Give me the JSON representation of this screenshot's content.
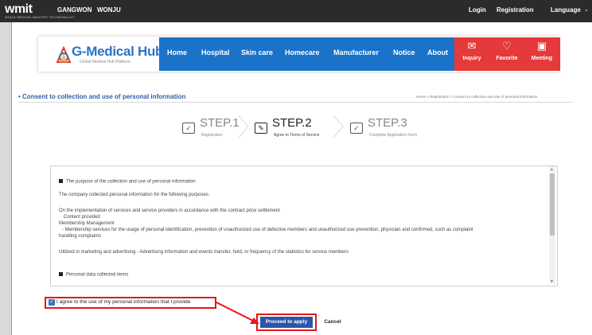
{
  "topbar": {
    "logo": "wmit",
    "logo_sub": "WONJU MEDICAL INDUSTRY TECHNOVALLEY",
    "region_1": "GANGWON",
    "region_2": "WONJU",
    "login": "Login",
    "registration": "Registration",
    "language": "Language"
  },
  "brand": {
    "title": "G-Medical Hub",
    "subtitle": "Global Medical Hub Platform"
  },
  "nav": {
    "items": [
      "Home",
      "Hospital",
      "Skin care",
      "Homecare",
      "Manufacturer",
      "Notice",
      "About"
    ],
    "actions": [
      {
        "label": "Inquiry",
        "icon": "envelope-icon"
      },
      {
        "label": "Favorite",
        "icon": "heart-icon"
      },
      {
        "label": "Meeting",
        "icon": "calendar-icon"
      }
    ],
    "blue": "#1a72c9",
    "red": "#e5393a"
  },
  "page": {
    "title": "Consent to collection and use of personal information",
    "breadcrumb": "Home > Registration > Consent to collection and use of personal information"
  },
  "steps": [
    {
      "name": "STEP.1",
      "sub": "Registration",
      "active": false
    },
    {
      "name": "STEP.2",
      "sub": "Agree to Terms of Service",
      "active": true
    },
    {
      "name": "STEP.3",
      "sub": "Complete Application Form",
      "active": false
    }
  ],
  "terms": {
    "heading": "The purpose of the collection and use of personal information",
    "p1": "The company collected personal information for the following purposes.",
    "p2": "On the implementation of services and service providers in accordance with the contract price settlement",
    "p3": "Content provided",
    "p4": "Membership Management",
    "p5": "- Membership services for the usage of personal identification, prevention of unauthorized use of defective members and unauthorized use prevention, physician and confirmed, such as complaint",
    "p6": "handling complaints",
    "p7": "Utilized in marketing and advertising   - Advertising information and events transfer, hold, or frequency of the statistics for service members",
    "heading2": "Personal data collected items"
  },
  "agree": {
    "label": "I agree to the use of my personal information that I provide",
    "checked": true
  },
  "buttons": {
    "proceed": "Proceed to apply",
    "cancel": "Cancel"
  },
  "colors": {
    "highlight": "#e8151b",
    "primary_button": "#2a56a8"
  }
}
